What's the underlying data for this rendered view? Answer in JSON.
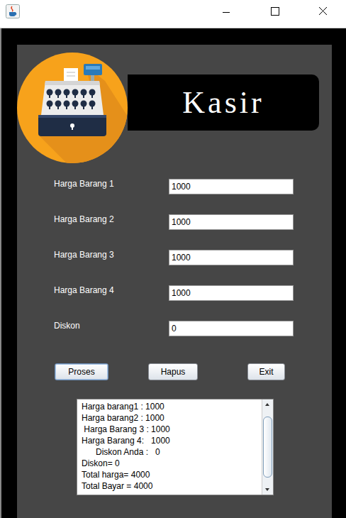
{
  "header": {
    "title": "Kasir"
  },
  "fields": [
    {
      "label": "Harga Barang 1",
      "value": "1000"
    },
    {
      "label": "Harga Barang 2",
      "value": "1000"
    },
    {
      "label": "Harga Barang 3",
      "value": "1000"
    },
    {
      "label": "Harga Barang 4",
      "value": "1000"
    },
    {
      "label": "Diskon",
      "value": "0"
    }
  ],
  "buttons": [
    {
      "label": "Proses",
      "focused": true
    },
    {
      "label": "Hapus",
      "focused": false
    },
    {
      "label": "Exit",
      "focused": false
    }
  ],
  "output": {
    "lines": [
      "Harga barang1 : 1000",
      "Harga barang2 : 1000",
      " Harga Barang 3 : 1000",
      "Harga Barang 4:   1000",
      "      Diskon Anda :   0",
      "Diskon= 0",
      "Total harga= 4000",
      "Total Bayar = 4000"
    ],
    "scrollbar": {
      "level": 0.82
    }
  }
}
